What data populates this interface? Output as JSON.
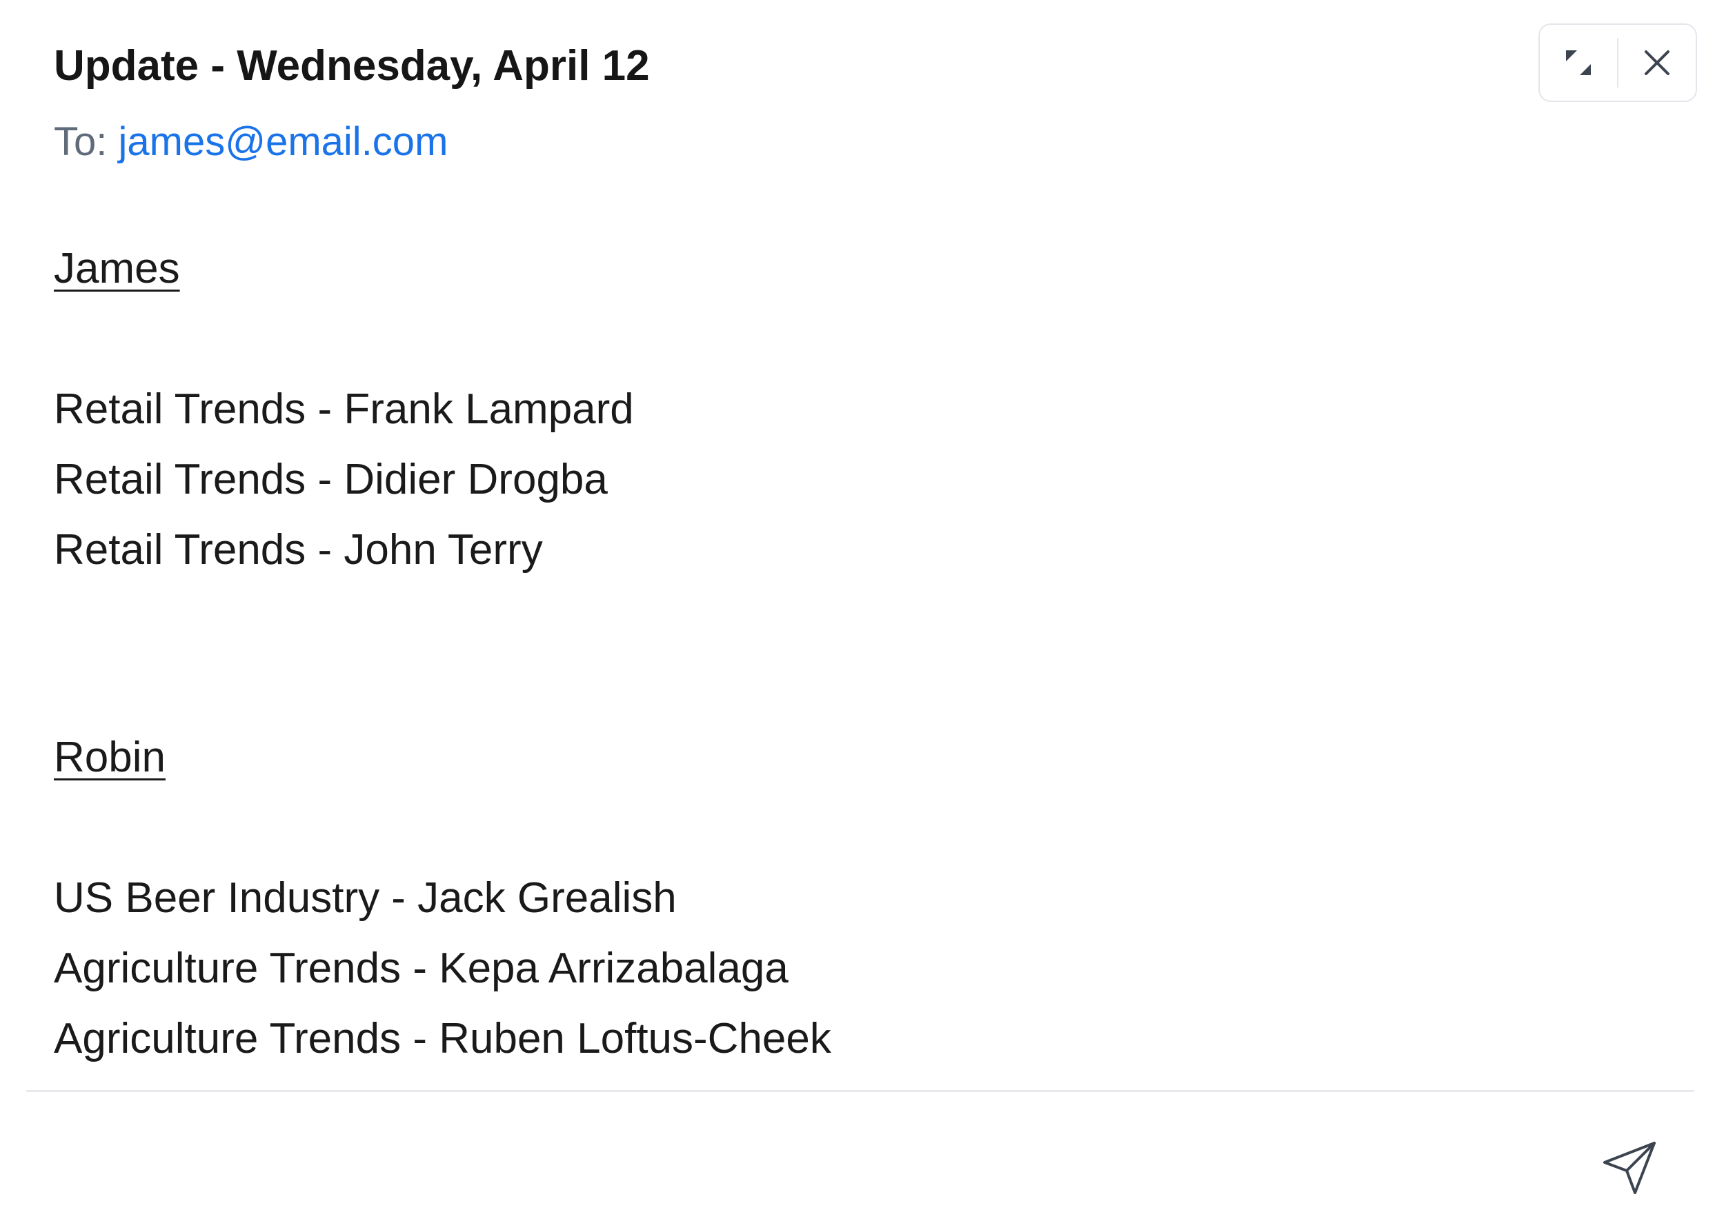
{
  "email": {
    "subject": "Update - Wednesday, April 12",
    "to_label": "To:",
    "to_address": "james@email.com",
    "sections": [
      {
        "person": "James",
        "items": [
          "Retail Trends - Frank Lampard",
          "Retail Trends - Didier Drogba",
          "Retail Trends - John Terry"
        ]
      },
      {
        "person": "Robin",
        "items": [
          "US Beer Industry - Jack Grealish",
          "Agriculture Trends - Kepa Arrizabalaga",
          "Agriculture Trends - Ruben Loftus-Cheek"
        ]
      }
    ]
  },
  "icons": {
    "collapse": "collapse-icon",
    "close": "close-icon",
    "send": "send-icon"
  },
  "colors": {
    "link": "#1a73e8",
    "muted": "#5f6b7a",
    "border": "#e3e6ea"
  }
}
